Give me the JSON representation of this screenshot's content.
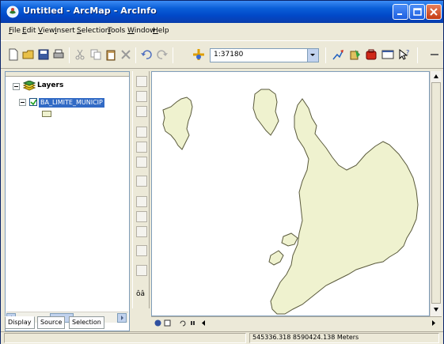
{
  "window": {
    "title": "Untitled - ArcMap - ArcInfo"
  },
  "menu": {
    "items": [
      {
        "accel": "F",
        "rest": "ile"
      },
      {
        "accel": "E",
        "rest": "dit"
      },
      {
        "accel": "V",
        "rest": "iew"
      },
      {
        "accel": "I",
        "rest": "nsert"
      },
      {
        "accel": "S",
        "rest": "election"
      },
      {
        "accel": "T",
        "rest": "ools"
      },
      {
        "accel": "W",
        "rest": "indow"
      },
      {
        "accel": "H",
        "rest": "elp"
      }
    ]
  },
  "toolbar": {
    "scale_value": "1:37180"
  },
  "toc": {
    "root_label": "Layers",
    "layer_name": "BA_LIMITE_MUNICIP",
    "tabs": [
      "Display",
      "Source",
      "Selection"
    ]
  },
  "status": {
    "coordinates": "545336.318  8590424.138 Meters"
  },
  "colors": {
    "titlebar": "#0a5fd8",
    "map_fill": "#eff2cf",
    "map_outline": "#5a5a3c",
    "selection": "#316ac5"
  }
}
